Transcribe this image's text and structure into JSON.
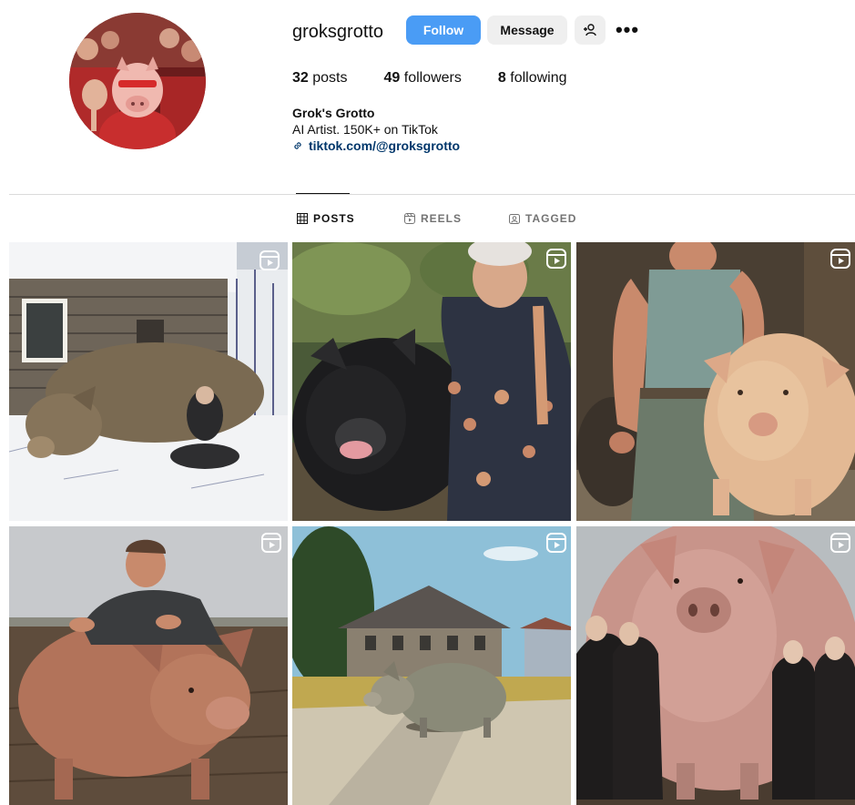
{
  "profile": {
    "username": "groksgrotto",
    "follow_label": "Follow",
    "message_label": "Message",
    "more_label": "•••"
  },
  "stats": {
    "posts_count": "32",
    "posts_label": "posts",
    "followers_count": "49",
    "followers_label": "followers",
    "following_count": "8",
    "following_label": "following"
  },
  "bio": {
    "name": "Grok's Grotto",
    "text": "AI Artist. 150K+ on TikTok",
    "link": "tiktok.com/@groksgrotto"
  },
  "tabs": [
    {
      "label": "POSTS",
      "active": true
    },
    {
      "label": "REELS",
      "active": false
    },
    {
      "label": "TAGGED",
      "active": false
    }
  ],
  "colors": {
    "follow_button": "#4a9cf5",
    "secondary_button": "#efefef",
    "link": "#00376b",
    "divider": "#dbdbdb"
  },
  "grid": [
    {
      "icon": "reel-icon",
      "content": "giant pig lying in snow next to a wooden house with a woman in black"
    },
    {
      "icon": "reel-icon",
      "content": "large black pig next to a woman in a floral dress"
    },
    {
      "icon": "reel-icon",
      "content": "muscular old man in a tank top beside a large pink pig"
    },
    {
      "icon": "reel-icon",
      "content": "smiling man lying on the back of a huge pig in a field"
    },
    {
      "icon": "reel-icon",
      "content": "giant pig on a road in front of a stone building"
    },
    {
      "icon": "reel-icon",
      "content": "enormous pig standing behind a group of people"
    }
  ]
}
